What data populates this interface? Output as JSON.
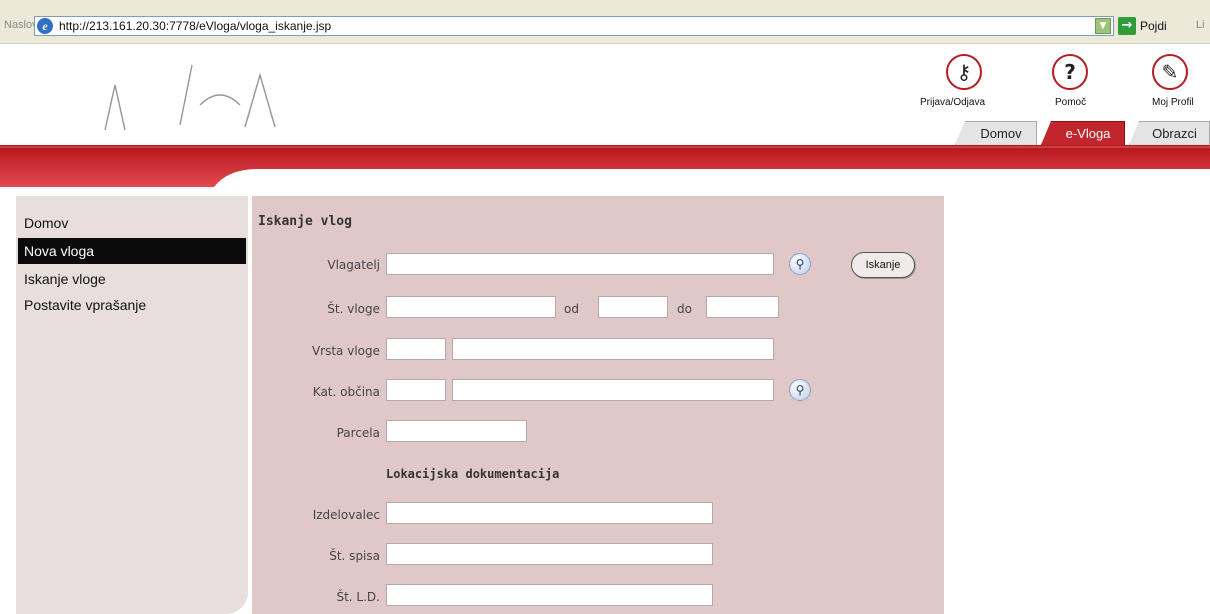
{
  "browser": {
    "address_label": "Naslov",
    "url": "http://213.161.20.30:7778/eVloga/vloga_iskanje.jsp",
    "go_label": "Pojdi",
    "links_label": "Li"
  },
  "header": {
    "icons": [
      {
        "icon": "key-icon",
        "label": "Prijava/Odjava"
      },
      {
        "icon": "help-icon",
        "label": "Pomoč"
      },
      {
        "icon": "profile-icon",
        "label": "Moj Profil"
      }
    ],
    "tabs": [
      {
        "label": "Domov",
        "active": false
      },
      {
        "label": "e-Vloga",
        "active": true
      },
      {
        "label": "Obrazci",
        "active": false
      }
    ]
  },
  "sidebar": {
    "items": [
      {
        "label": "Domov",
        "active": false
      },
      {
        "label": "Nova vloga",
        "active": true
      },
      {
        "label": "Iskanje vloge",
        "active": false
      },
      {
        "label": "Postavite vprašanje",
        "active": false
      }
    ]
  },
  "form": {
    "title": "Iskanje vlog",
    "search_button": "Iskanje",
    "fields": {
      "vlagatelj": "Vlagatelj",
      "st_vloge": "Št. vloge",
      "od": "od",
      "do": "do",
      "vrsta_vloge": "Vrsta vloge",
      "kat_obcina": "Kat. občina",
      "parcela": "Parcela"
    },
    "section_title": "Lokacijska dokumentacija",
    "lokacijska": {
      "izdelovalec": "Izdelovalec",
      "st_spisa": "Št. spisa",
      "st_ld": "Št. L.D."
    }
  },
  "colors": {
    "brand_red": "#c0262c",
    "panel_bg": "#e0c8c9",
    "sidebar_bg": "#e8dede"
  }
}
